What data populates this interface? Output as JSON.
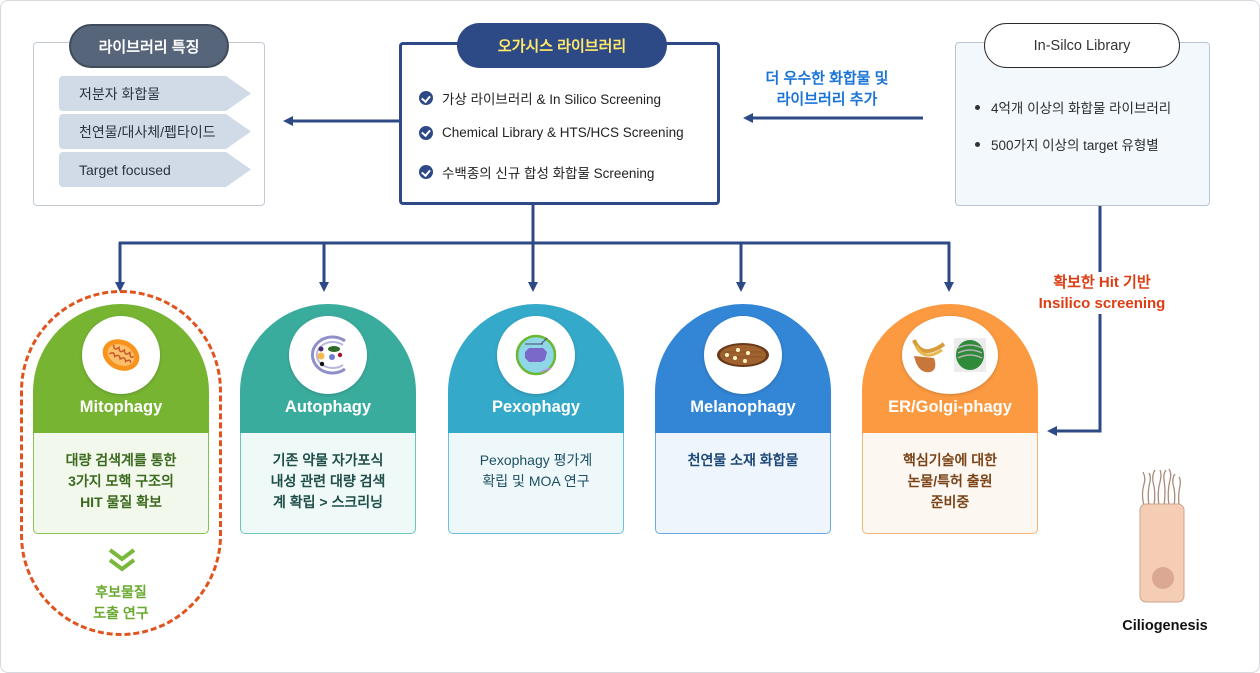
{
  "features": {
    "title": "라이브러리 특징",
    "items": [
      "저분자 화합물",
      "천연물/대사체/펩타이드",
      "Target focused"
    ]
  },
  "center": {
    "title": "오가시스 라이브러리",
    "items": [
      "가상 라이브러리 & In Silico Screening",
      "Chemical Library & HTS/HCS Screening",
      "수백종의 신규 합성 화합물 Screening"
    ]
  },
  "insilico": {
    "title": "In-Silco Library",
    "items": [
      "4억개 이상의 화합물 라이브러리",
      "500가지 이상의 target 유형별"
    ]
  },
  "annotations": {
    "add_line1": "더 우수한 화합물 및",
    "add_line2": "라이브러리 추가",
    "hit_line1": "확보한 Hit 기반",
    "hit_line2": "Insilico screening"
  },
  "colors": {
    "navy": "#2e4a86",
    "highlight_dash": "#e0531c",
    "mitophagy": "#76b432",
    "autophagy": "#3aac9e",
    "pexophagy": "#35a9c9",
    "melanophagy": "#3385d6",
    "er_golgi": "#fb9a41"
  },
  "cards": [
    {
      "title": "Mitophagy",
      "icon": "mitochondria-icon",
      "lines": [
        "대량 검색계를 통한",
        "3가지 모핵 구조의",
        "HIT 물질 확보"
      ]
    },
    {
      "title": "Autophagy",
      "icon": "autophagosome-icon",
      "lines": [
        "기존 약물 자가포식",
        "내성 관련 대량 검색",
        "계 확립 > 스크리닝"
      ]
    },
    {
      "title": "Pexophagy",
      "icon": "peroxisome-icon",
      "lines": [
        "Pexophagy 평가계",
        "확립 및 MOA 연구"
      ]
    },
    {
      "title": "Melanophagy",
      "icon": "melanosome-icon",
      "lines": [
        "천연물 소재 화합물"
      ]
    },
    {
      "title": "ER/Golgi-phagy",
      "icon": "er-golgi-icon",
      "lines": [
        "핵심기술에 대한",
        "논물/특허 출원",
        "준비중"
      ]
    }
  ],
  "result": {
    "line1": "후보물질",
    "line2": "도출 연구"
  },
  "ciliogenesis": {
    "label": "Ciliogenesis"
  }
}
